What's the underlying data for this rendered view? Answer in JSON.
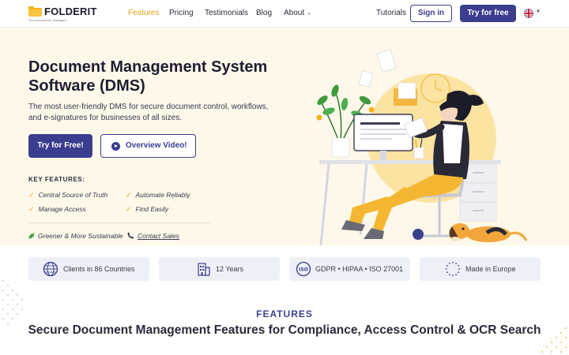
{
  "brand": {
    "name": "FOLDERIT",
    "tagline": "Your documents. Managed.",
    "primary_color": "#3b3e8f",
    "accent_color": "#e2a21b"
  },
  "nav": {
    "links": [
      {
        "label": "Features",
        "active": true
      },
      {
        "label": "Pricing"
      },
      {
        "label": "Testimonials"
      },
      {
        "label": "Blog"
      },
      {
        "label": "About",
        "has_dropdown": true
      }
    ],
    "tutorials": "Tutorials",
    "sign_in": "Sign in",
    "try_free": "Try for free",
    "language_icon": "uk-flag-icon"
  },
  "hero": {
    "title": "Document Management System Software (DMS)",
    "subtitle": "The most user-friendly DMS for secure document control, workflows, and e-signatures for businesses of all sizes.",
    "cta_primary": "Try for Free!",
    "cta_secondary": "Overview Video!",
    "key_features_title": "KEY FEATURES:",
    "features": [
      "Central Source of Truth",
      "Automate Reliably",
      "Manage Access",
      "Find Easily"
    ],
    "extra": {
      "greener": "Greener & More Sustainable",
      "contact": "Contact Sales"
    }
  },
  "badges": [
    {
      "icon": "globe-icon",
      "label": "Clients in 86 Countries"
    },
    {
      "icon": "building-icon",
      "label": "12 Years"
    },
    {
      "icon": "iso-icon",
      "label": "GDPR • HIPAA • ISO 27001"
    },
    {
      "icon": "eu-stars-icon",
      "label": "Made in Europe"
    }
  ],
  "features_section": {
    "kicker": "FEATURES",
    "title": "Secure Document Management Features for Compliance, Access Control & OCR Search"
  }
}
